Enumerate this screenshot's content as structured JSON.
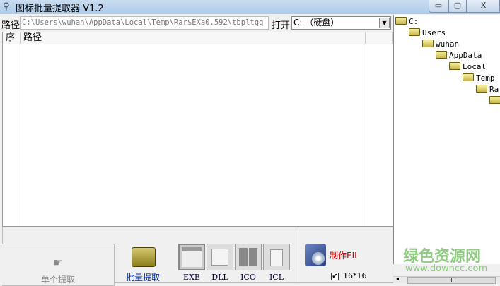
{
  "window": {
    "title": "图标批量提取器 V1.2",
    "minimize": "▭",
    "maximize": "▢",
    "close": "X"
  },
  "toolbar": {
    "path_label": "路径",
    "path_value": "C:\\Users\\wuhan\\AppData\\Local\\Temp\\Rar$EXa0.592\\tbpltqq",
    "open_label": "打开",
    "drive_value": "C: （硬盘）"
  },
  "list": {
    "columns": [
      "序",
      "路径"
    ]
  },
  "bottom": {
    "single_extract": "单个提取",
    "batch_extract": "批量提取",
    "types": [
      "EXE",
      "DLL",
      "ICO",
      "ICL"
    ],
    "make_eil": "制作EIL",
    "size_checkbox": "16*16",
    "size_checked": true
  },
  "tree": {
    "nodes": [
      "C:",
      "Users",
      "wuhan",
      "AppData",
      "Local",
      "Temp",
      "Rar",
      ""
    ]
  },
  "watermark": {
    "name": "绿色资源网",
    "url": "www.downcc.com"
  },
  "scrollbar": {
    "thumb": "III"
  }
}
